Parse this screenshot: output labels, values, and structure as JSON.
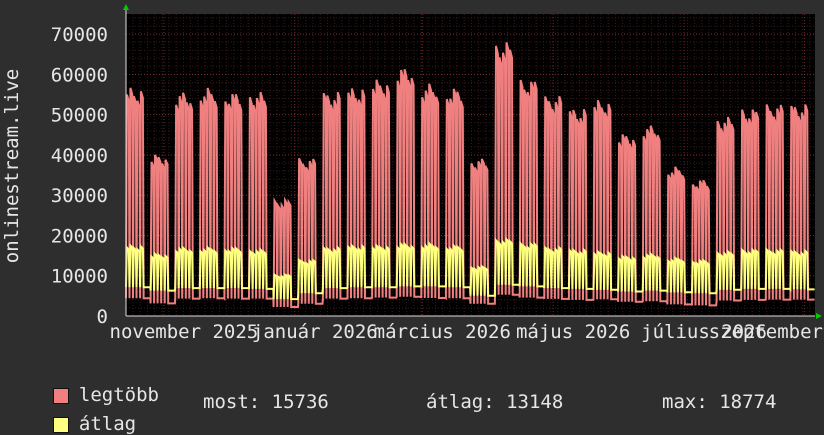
{
  "chart_data": {
    "type": "line",
    "ylabel": "onlinestream.live",
    "ylim": [
      0,
      75000
    ],
    "yticks": [
      0,
      10000,
      20000,
      30000,
      40000,
      50000,
      60000,
      70000
    ],
    "ytick_labels": [
      "0",
      "10000",
      "20000",
      "30000",
      "40000",
      "50000",
      "60000",
      "70000"
    ],
    "xtick_labels": [
      "november 2025",
      "január 2026",
      "március 2026",
      "május 2026",
      "július 2026",
      "szeptember"
    ],
    "xticks_frac": [
      0.055,
      0.245,
      0.43,
      0.62,
      0.81,
      0.985
    ],
    "grid": true,
    "series": [
      {
        "name": "legtöbb",
        "color": "#f08080",
        "weekly": [
          55000,
          39000,
          54000,
          55000,
          54000,
          54000,
          28000,
          38000,
          54000,
          55000,
          57000,
          60000,
          56000,
          55000,
          38000,
          66000,
          57000,
          53000,
          50000,
          52000,
          44000,
          46000,
          36000,
          33000,
          48000,
          50000,
          51000,
          51000
        ]
      },
      {
        "name": "átlag",
        "color": "#ffff80",
        "weekly": [
          17000,
          15000,
          16500,
          16500,
          16500,
          16000,
          10000,
          13500,
          16500,
          17000,
          17000,
          17500,
          17500,
          17000,
          12000,
          18500,
          17500,
          16500,
          16000,
          15500,
          14500,
          15000,
          14000,
          13500,
          15500,
          16000,
          16000,
          15700
        ]
      }
    ]
  },
  "legend": {
    "max_label": "legtöbb",
    "avg_label": "átlag"
  },
  "stats": {
    "now": "most: 15736",
    "avg": "átlag: 13148",
    "max": "max: 18774"
  }
}
